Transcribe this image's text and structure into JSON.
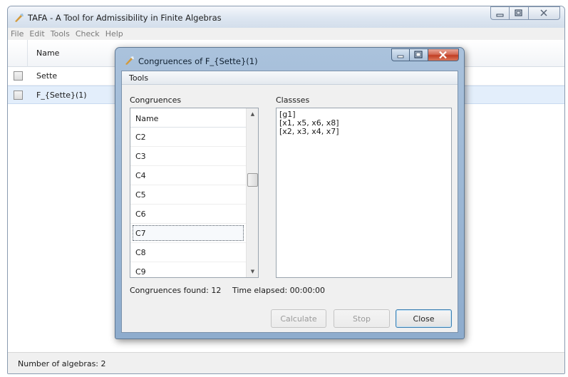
{
  "main_window": {
    "title": "TAFA - A Tool for Admissibility in Finite Algebras",
    "menu": [
      "File",
      "Edit",
      "Tools",
      "Check",
      "Help"
    ],
    "table": {
      "column_header": "Name",
      "rows": [
        {
          "label": "Sette",
          "selected": false
        },
        {
          "label": "F_{Sette}(1)",
          "selected": true
        }
      ]
    },
    "status": "Number of algebras: 2"
  },
  "dialog": {
    "title": "Congruences of F_{Sette}(1)",
    "toolbar_label": "Tools",
    "congruences_label": "Congruences",
    "classes_label": "Classses",
    "list_header": "Name",
    "congruences": [
      "C2",
      "C3",
      "C4",
      "C5",
      "C6",
      "C7",
      "C8",
      "C9"
    ],
    "selected_congruence": "C7",
    "classes": [
      "[g1]",
      "[x1, x5, x6, x8]",
      "[x2, x3, x4, x7]"
    ],
    "found_text": "Congruences found: 12",
    "elapsed_text": "Time elapsed: 00:00:00",
    "buttons": {
      "calculate": "Calculate",
      "stop": "Stop",
      "close": "Close"
    }
  },
  "icons": {
    "app": "tafa-app-icon",
    "window_controls": [
      "minimize-icon",
      "maximize-icon",
      "close-icon"
    ],
    "scroll": [
      "scroll-up-icon",
      "scroll-down-icon"
    ]
  },
  "colors": {
    "dialog_frame": "#8eaccd",
    "close_button": "#c23e24",
    "selection": "#e3eefb"
  }
}
